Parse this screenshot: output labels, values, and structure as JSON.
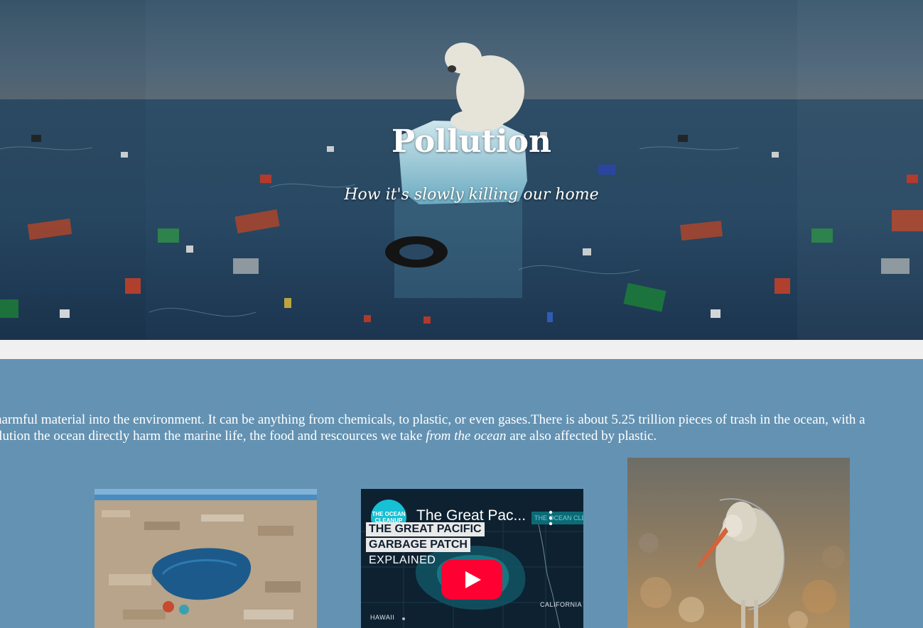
{
  "hero": {
    "title": "Pollution",
    "subtitle": "How it's slowly killing our home"
  },
  "intro": {
    "line1": " harmful material into the environment. It can be anything from chemicals, to plastic, or even gases.There is about 5.25 trillion pieces of trash in the ocean, with a",
    "line2_before": "llution the ocean directly harm the marine life, the food and rescources we take ",
    "line2_italic": "from the ocean",
    "line2_after": " are also affected by plastic."
  },
  "video": {
    "title": "The Great Pac...",
    "logo_text": "THE OCEAN CLEANUP",
    "brand_text": "THE OCEAN CLEANUP",
    "label_line1": "THE GREAT PACIFIC",
    "label_line2": "GARBAGE PATCH",
    "explained": "EXPLAINED",
    "map_label_california": "CALIFORNIA",
    "map_label_hawaii": "HAWAII"
  },
  "icons": {
    "more": "more-vert-icon",
    "play": "play-icon"
  },
  "colors": {
    "section_bg": "#6492b2",
    "gap_bg": "#f0f0f0",
    "play_red": "#ff0033",
    "logo_teal": "#17c0d4"
  }
}
